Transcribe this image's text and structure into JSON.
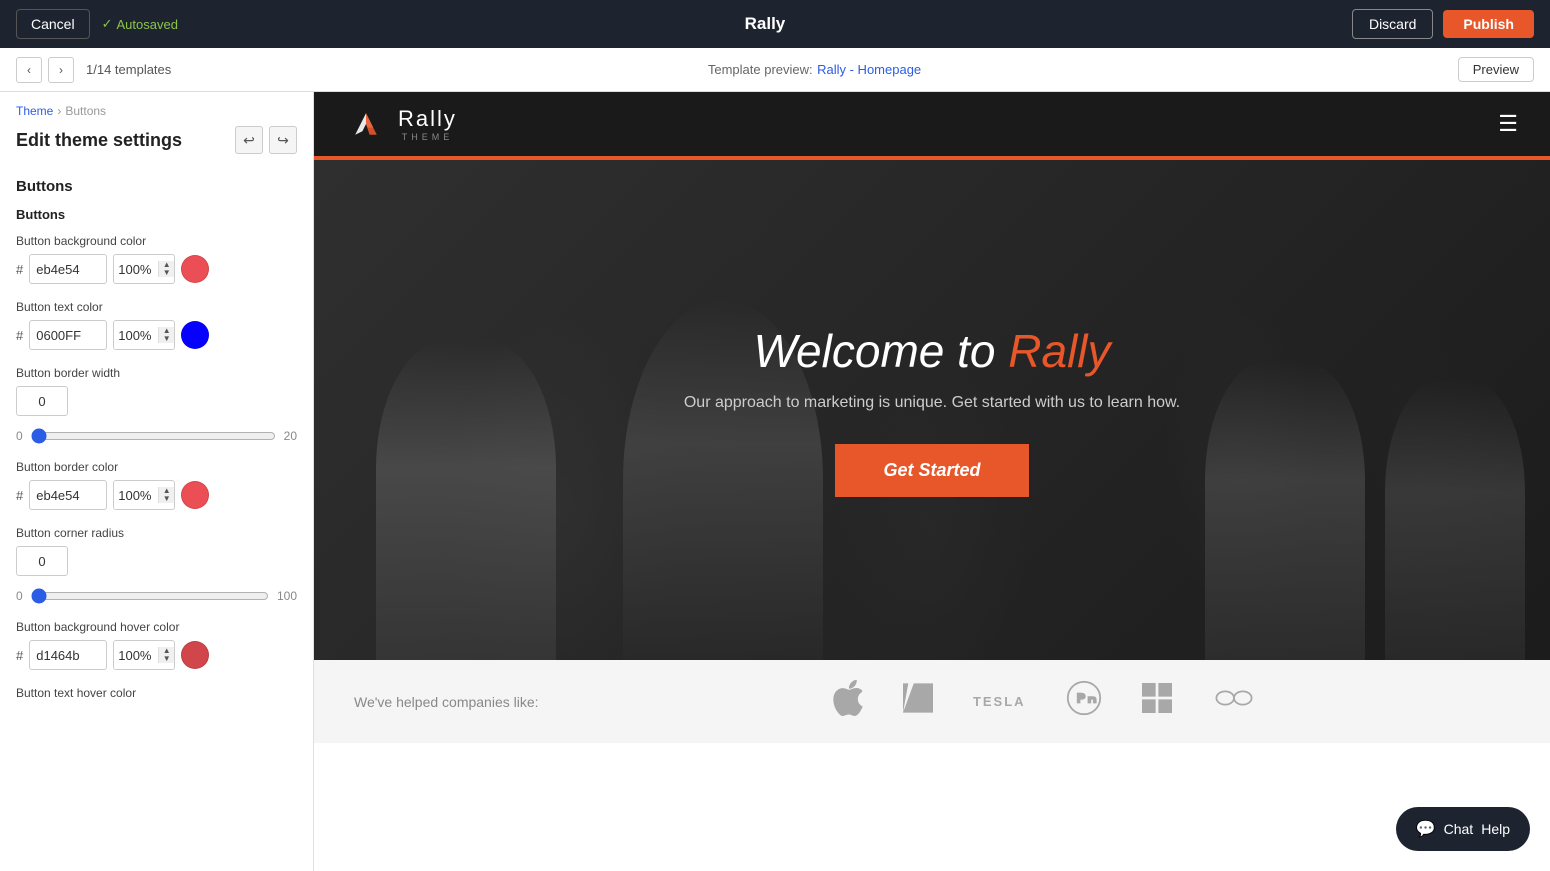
{
  "topBar": {
    "cancel_label": "Cancel",
    "autosaved_label": "Autosaved",
    "app_title": "Rally",
    "discard_label": "Discard",
    "publish_label": "Publish"
  },
  "templateBar": {
    "template_count": "1/14 templates",
    "preview_label": "Template preview:",
    "template_name": "Rally - Homepage",
    "preview_button": "Preview"
  },
  "leftPanel": {
    "breadcrumb_theme": "Theme",
    "breadcrumb_separator": "›",
    "breadcrumb_buttons": "Buttons",
    "panel_title": "Edit theme settings",
    "section_title": "Buttons",
    "section_subtitle": "Buttons",
    "fields": {
      "bg_color_label": "Button background color",
      "bg_color_hex": "eb4e54",
      "bg_color_opacity": "100%",
      "text_color_label": "Button text color",
      "text_color_hex": "0600FF",
      "text_color_opacity": "100%",
      "border_width_label": "Button border width",
      "border_width_value": "0",
      "slider1_min": "0",
      "slider1_max": "20",
      "border_color_label": "Button border color",
      "border_color_hex": "eb4e54",
      "border_color_opacity": "100%",
      "corner_radius_label": "Button corner radius",
      "corner_radius_value": "0",
      "slider2_min": "0",
      "slider2_max": "100",
      "hover_bg_color_label": "Button background hover color",
      "hover_bg_color_hex": "d1464b",
      "hover_bg_color_opacity": "100%",
      "hover_text_color_label": "Button text hover color"
    }
  },
  "preview": {
    "site_name": "Rally",
    "site_theme": "THEME",
    "hero_title_part1": "Welcome to ",
    "hero_title_accent": "Rally",
    "hero_subtitle": "Our approach to marketing is unique. Get started with us to learn how.",
    "hero_cta": "Get Started",
    "logos_text": "We've helped companies like:"
  },
  "chat": {
    "chat_label": "Chat",
    "help_label": "Help"
  },
  "colors": {
    "bg_red": "#eb4e54",
    "text_blue": "#0600FF",
    "hover_red": "#d1464b",
    "accent_orange": "#e8572a"
  }
}
